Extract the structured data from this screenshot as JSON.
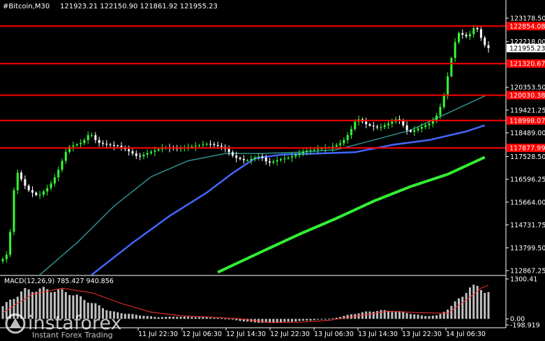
{
  "header": {
    "symbol": "#Bitcoin,M30",
    "ohlc": "121923.21 122150.90 121861.92 121955.23"
  },
  "colors": {
    "background": "#000000",
    "axis": "#ffffff",
    "bull": "#33ff33",
    "bear": "#ffffff",
    "level": "#ff0000",
    "ma_fast": "#2f8f8f",
    "ma_mid": "#4466ff",
    "ma_slow": "#33ee33",
    "macd_hist": "#c0c0c0",
    "macd_signal": "#ff3333"
  },
  "watermark": {
    "brand": "instaforex",
    "tagline": "Instant Forex Trading",
    "logo_icon": "instaforex-logo-icon"
  },
  "chart_data": {
    "type": "candlestick",
    "price_axis": {
      "min": 112867.25,
      "max": 123178.5,
      "ticks": [
        {
          "value": 123178.5,
          "label": "123178.50"
        },
        {
          "value": 122218.0,
          "label": "122218.00"
        },
        {
          "value": 120353.5,
          "label": "120353.50"
        },
        {
          "value": 119421.25,
          "label": "119421.25"
        },
        {
          "value": 118489.0,
          "label": "118489.00"
        },
        {
          "value": 117528.5,
          "label": "117528.50"
        },
        {
          "value": 116596.25,
          "label": "116596.25"
        },
        {
          "value": 115664.0,
          "label": "115664.00"
        },
        {
          "value": 114731.75,
          "label": "114731.75"
        },
        {
          "value": 113799.5,
          "label": "113799.50"
        },
        {
          "value": 112867.25,
          "label": "112867.25"
        }
      ]
    },
    "current_price": {
      "value": 121955.23,
      "label": "121955.23"
    },
    "levels": [
      {
        "value": 122854.08,
        "label": "122854.08"
      },
      {
        "value": 121320.67,
        "label": "121320.67"
      },
      {
        "value": 120030.38,
        "label": "120030.38"
      },
      {
        "value": 118998.07,
        "label": "118998.07"
      },
      {
        "value": 117877.99,
        "label": "117877.99"
      }
    ],
    "time_labels": [
      "11 Jul 22:30",
      "12 Jul 06:30",
      "12 Jul 14:30",
      "12 Jul 22:30",
      "13 Jul 06:30",
      "13 Jul 14:30",
      "13 Jul 22:30",
      "14 Jul 06:30"
    ],
    "price_path": [
      [
        0,
        113250
      ],
      [
        2,
        113600
      ],
      [
        4,
        117000
      ],
      [
        7,
        116200
      ],
      [
        10,
        115900
      ],
      [
        13,
        116300
      ],
      [
        15,
        116800
      ],
      [
        18,
        117900
      ],
      [
        22,
        118100
      ],
      [
        24,
        118500
      ],
      [
        26,
        118100
      ],
      [
        29,
        118000
      ],
      [
        32,
        117950
      ],
      [
        35,
        117700
      ],
      [
        37,
        117500
      ],
      [
        40,
        117700
      ],
      [
        44,
        117900
      ],
      [
        48,
        117850
      ],
      [
        52,
        117950
      ],
      [
        56,
        118050
      ],
      [
        60,
        117900
      ],
      [
        63,
        117500
      ],
      [
        66,
        117350
      ],
      [
        70,
        117550
      ],
      [
        72,
        117250
      ],
      [
        75,
        117400
      ],
      [
        78,
        117500
      ],
      [
        82,
        117750
      ],
      [
        86,
        117850
      ],
      [
        89,
        117900
      ],
      [
        92,
        118100
      ],
      [
        94,
        118500
      ],
      [
        96,
        119100
      ],
      [
        99,
        118800
      ],
      [
        102,
        118700
      ],
      [
        105,
        118900
      ],
      [
        107,
        119100
      ],
      [
        110,
        118500
      ],
      [
        113,
        118700
      ],
      [
        116,
        118900
      ],
      [
        118,
        119300
      ],
      [
        120,
        120300
      ],
      [
        121,
        121300
      ],
      [
        122,
        121800
      ],
      [
        123,
        122600
      ],
      [
        126,
        122400
      ],
      [
        128,
        122900
      ],
      [
        130,
        122200
      ],
      [
        131,
        121955.23
      ]
    ],
    "moving_averages": [
      {
        "color": "#2f8f8f",
        "points": [
          [
            10,
            112600
          ],
          [
            20,
            114000
          ],
          [
            30,
            115500
          ],
          [
            40,
            116700
          ],
          [
            50,
            117350
          ],
          [
            60,
            117650
          ],
          [
            70,
            117650
          ],
          [
            80,
            117700
          ],
          [
            90,
            117800
          ],
          [
            100,
            118200
          ],
          [
            110,
            118600
          ],
          [
            120,
            119300
          ],
          [
            130,
            120000
          ]
        ]
      },
      {
        "color": "#4466ff",
        "points": [
          [
            24,
            112600
          ],
          [
            35,
            114000
          ],
          [
            45,
            115100
          ],
          [
            55,
            116050
          ],
          [
            62,
            116850
          ],
          [
            68,
            117450
          ],
          [
            75,
            117600
          ],
          [
            85,
            117650
          ],
          [
            95,
            117700
          ],
          [
            105,
            118000
          ],
          [
            115,
            118200
          ],
          [
            125,
            118550
          ],
          [
            130,
            118800
          ]
        ]
      },
      {
        "color": "#33ee33",
        "points": [
          [
            58,
            112800
          ],
          [
            70,
            113650
          ],
          [
            80,
            114350
          ],
          [
            90,
            115000
          ],
          [
            100,
            115700
          ],
          [
            110,
            116300
          ],
          [
            120,
            116800
          ],
          [
            130,
            117500
          ]
        ]
      }
    ],
    "indicator": {
      "name": "MACD",
      "params": "(12,26,9)",
      "values_label": "785.427 940.856",
      "axis_ticks": [
        {
          "value": 1300.41,
          "label": "1300.41"
        },
        {
          "value": 0.0,
          "label": "0.00"
        },
        {
          "value": -198.919,
          "label": "-198.919"
        }
      ],
      "range": [
        -198.919,
        1300.41
      ],
      "histogram_path": [
        [
          0,
          400
        ],
        [
          6,
          1000
        ],
        [
          12,
          1050
        ],
        [
          18,
          950
        ],
        [
          24,
          600
        ],
        [
          30,
          250
        ],
        [
          36,
          150
        ],
        [
          42,
          60
        ],
        [
          48,
          80
        ],
        [
          54,
          60
        ],
        [
          60,
          20
        ],
        [
          66,
          -100
        ],
        [
          72,
          -150
        ],
        [
          78,
          -100
        ],
        [
          84,
          -50
        ],
        [
          90,
          30
        ],
        [
          96,
          200
        ],
        [
          102,
          300
        ],
        [
          108,
          250
        ],
        [
          114,
          100
        ],
        [
          118,
          120
        ],
        [
          122,
          500
        ],
        [
          126,
          1050
        ],
        [
          129,
          1180
        ],
        [
          131,
          900
        ]
      ],
      "signal_path": [
        [
          0,
          200
        ],
        [
          8,
          800
        ],
        [
          16,
          1000
        ],
        [
          24,
          850
        ],
        [
          32,
          500
        ],
        [
          40,
          220
        ],
        [
          48,
          100
        ],
        [
          56,
          60
        ],
        [
          64,
          0
        ],
        [
          72,
          -120
        ],
        [
          80,
          -110
        ],
        [
          88,
          -50
        ],
        [
          96,
          100
        ],
        [
          104,
          250
        ],
        [
          112,
          200
        ],
        [
          120,
          180
        ],
        [
          126,
          700
        ],
        [
          129,
          1000
        ],
        [
          131,
          1100
        ]
      ]
    }
  }
}
